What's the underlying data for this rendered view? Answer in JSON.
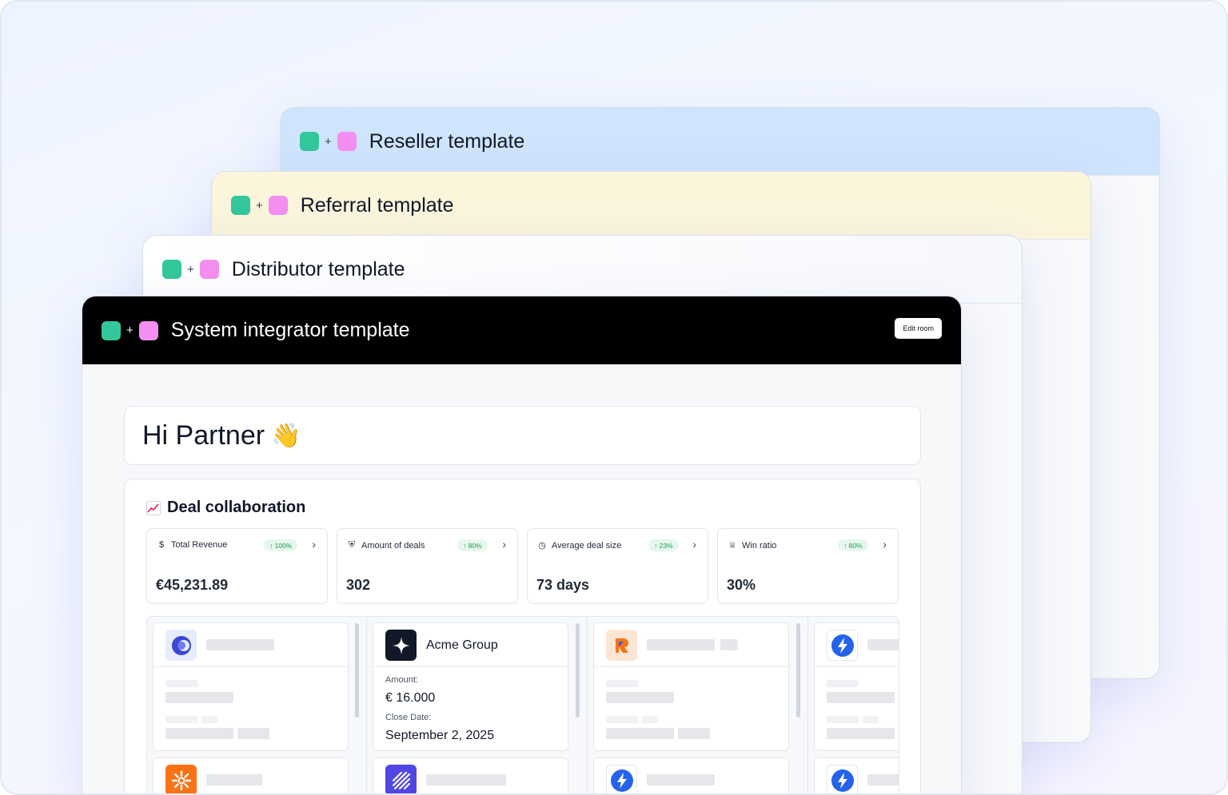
{
  "templates": [
    {
      "title": "Reseller template"
    },
    {
      "title": "Referral template"
    },
    {
      "title": "Distributor template"
    },
    {
      "title": "System integrator template"
    }
  ],
  "edit_room_label": "Edit room",
  "greeting": "Hi Partner",
  "greeting_emoji": "👋",
  "deal": {
    "title": "Deal collaboration",
    "metrics": [
      {
        "icon": "dollar-icon",
        "glyph": "$",
        "label": "Total Revenue",
        "badge": "↑ 100%",
        "value": "€45,231.89"
      },
      {
        "icon": "handshake-icon",
        "glyph": "⛨",
        "label": "Amount of deals",
        "badge": "↑ 80%",
        "value": "302"
      },
      {
        "icon": "clock-icon",
        "glyph": "◷",
        "label": "Average deal size",
        "badge": "↑ 23%",
        "value": "73 days"
      },
      {
        "icon": "trophy-icon",
        "glyph": "♕",
        "label": "Win ratio",
        "badge": "↑ 80%",
        "value": "30%"
      }
    ],
    "featured_card": {
      "name": "Acme Group",
      "amount_label": "Amount:",
      "amount": "€ 16.000",
      "close_label": "Close Date:",
      "close_date": "September 2, 2025"
    }
  },
  "colors": {
    "accent_green": "#33c79b",
    "accent_pink": "#f48ef0",
    "badge_green": "#16a34a"
  }
}
